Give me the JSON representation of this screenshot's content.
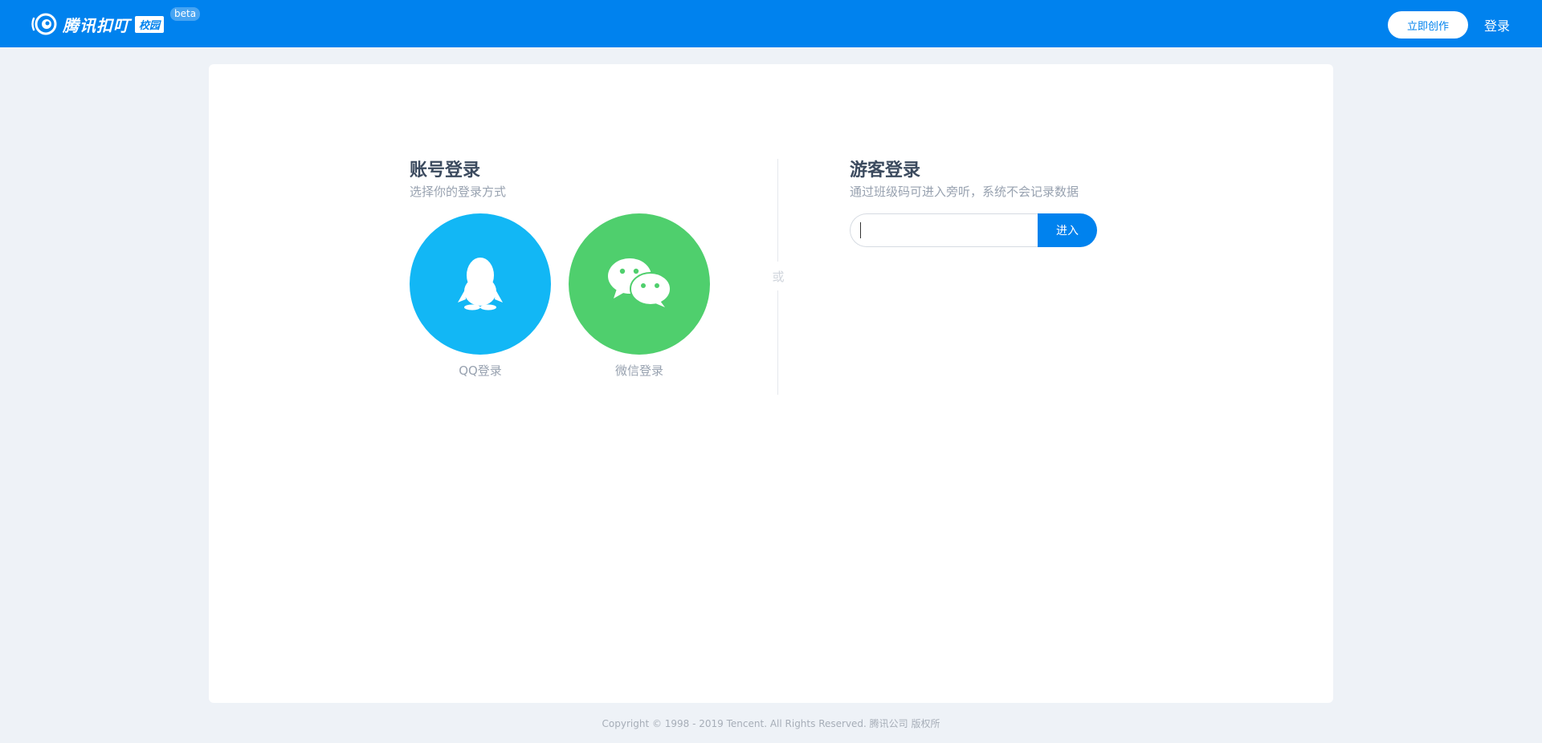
{
  "header": {
    "logo_text": "腾讯扣叮",
    "logo_campus": "校园",
    "logo_badge": "beta",
    "create_button": "立即创作",
    "login_link": "登录",
    "bg_color": "#0082ee"
  },
  "account_login": {
    "title": "账号登录",
    "subtitle": "选择你的登录方式",
    "options": [
      {
        "label": "QQ登录",
        "icon": "qq-penguin-icon",
        "color": "#12b7f5"
      },
      {
        "label": "微信登录",
        "icon": "wechat-icon",
        "color": "#4fcf6d"
      }
    ]
  },
  "divider": {
    "text": "或"
  },
  "guest_login": {
    "title": "游客登录",
    "subtitle": "通过班级码可进入旁听，系统不会记录数据",
    "input_value": "",
    "enter_button": "进入"
  },
  "footer": {
    "copyright": "Copyright © 1998 - 2019 Tencent. All Rights Reserved. 腾讯公司 版权所"
  }
}
